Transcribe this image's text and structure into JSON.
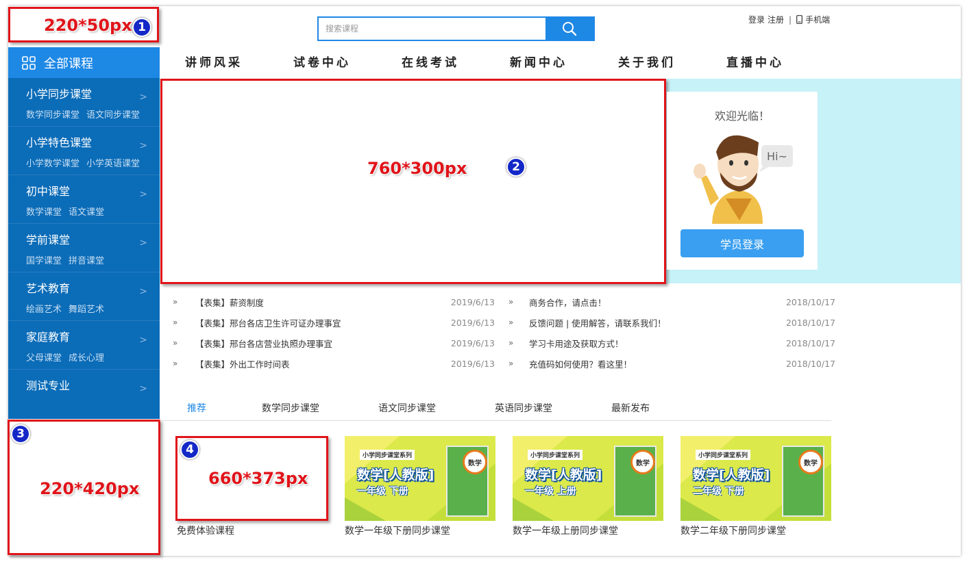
{
  "annotations": {
    "logo": {
      "label": "220*50px",
      "badge": "1"
    },
    "banner": {
      "label": "760*300px",
      "badge": "2"
    },
    "sidebar_bottom": {
      "label": "220*420px",
      "badge": "3"
    },
    "course_thumb": {
      "label": "660*373px",
      "badge": "4"
    }
  },
  "search": {
    "placeholder": "搜索课程"
  },
  "toplinks": {
    "login": "登录",
    "register": "注册",
    "sep": "|",
    "mobile": "手机端"
  },
  "nav": [
    "讲师风采",
    "试卷中心",
    "在线考试",
    "新闻中心",
    "关于我们",
    "直播中心"
  ],
  "sidebar": {
    "header": "全部课程",
    "categories": [
      {
        "title": "小学同步课堂",
        "subs": [
          "数学同步课堂",
          "语文同步课堂"
        ]
      },
      {
        "title": "小学特色课堂",
        "subs": [
          "小学数学课堂",
          "小学英语课堂"
        ]
      },
      {
        "title": "初中课堂",
        "subs": [
          "数学课堂",
          "语文课堂"
        ]
      },
      {
        "title": "学前课堂",
        "subs": [
          "国学课堂",
          "拼音课堂"
        ]
      },
      {
        "title": "艺术教育",
        "subs": [
          "绘画艺术",
          "舞蹈艺术"
        ]
      },
      {
        "title": "家庭教育",
        "subs": [
          "父母课堂",
          "成长心理"
        ]
      },
      {
        "title": "测试专业",
        "subs": []
      }
    ],
    "arrow": ">"
  },
  "login_card": {
    "welcome": "欢迎光临！",
    "hi": "Hi~",
    "button": "学员登录"
  },
  "news_left": [
    {
      "title": "【表集】薪资制度",
      "date": "2019/6/13"
    },
    {
      "title": "【表集】邢台各店卫生许可证办理事宜",
      "date": "2019/6/13"
    },
    {
      "title": "【表集】邢台各店营业执照办理事宜",
      "date": "2019/6/13"
    },
    {
      "title": "【表集】外出工作时间表",
      "date": "2019/6/13"
    }
  ],
  "news_right": [
    {
      "title": "商务合作，请点击！",
      "date": "2018/10/17"
    },
    {
      "title": "反馈问题 | 使用解答，请联系我们！",
      "date": "2018/10/17"
    },
    {
      "title": "学习卡用途及获取方式！",
      "date": "2018/10/17"
    },
    {
      "title": "充值码如何使用？看这里！",
      "date": "2018/10/17"
    }
  ],
  "news_marker": "»",
  "tabs": [
    {
      "label": "推荐",
      "active": true
    },
    {
      "label": "数学同步课堂",
      "active": false
    },
    {
      "label": "语文同步课堂",
      "active": false
    },
    {
      "label": "英语同步课堂",
      "active": false
    },
    {
      "label": "最新发布",
      "active": false
    }
  ],
  "courses": [
    {
      "title": "免费体验课程",
      "placeholder": true
    },
    {
      "title": "数学一年级下册同步课堂",
      "series": "小学同步课堂系列",
      "main": "数学[人教版]",
      "grade": "一年级 下册",
      "book": "数学"
    },
    {
      "title": "数学一年级上册同步课堂",
      "series": "小学同步课堂系列",
      "main": "数学[人教版]",
      "grade": "一年级 上册",
      "book": "数学"
    },
    {
      "title": "数学二年级下册同步课堂",
      "series": "小学同步课堂系列",
      "main": "数学[人教版]",
      "grade": "二年级 下册",
      "book": "数学"
    }
  ],
  "colors": {
    "primary": "#1e88e5",
    "sidebar": "#0b6cb8",
    "hero_bg": "#c6f2f8",
    "annotation": "#e0141a",
    "badge": "#1428c8"
  }
}
